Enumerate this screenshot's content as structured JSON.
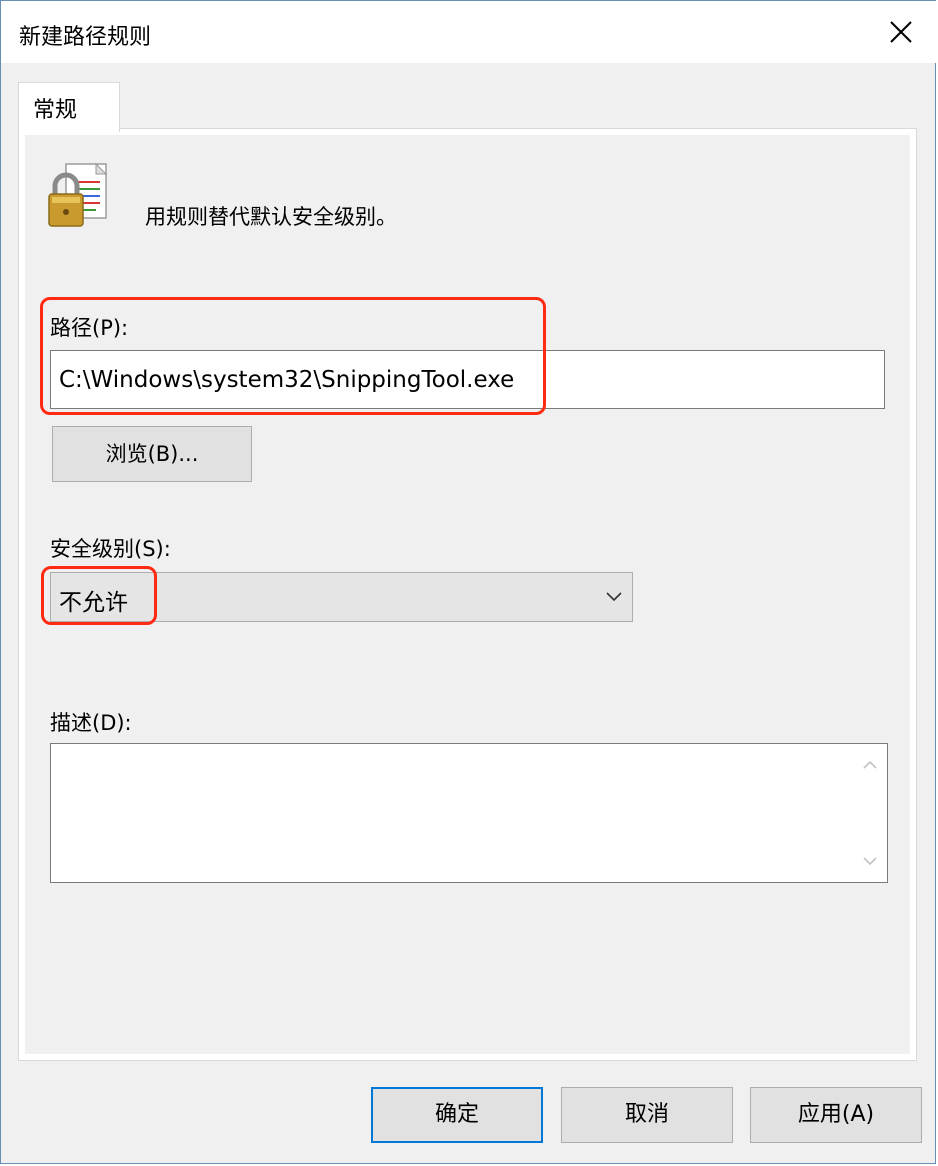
{
  "dialog": {
    "title": "新建路径规则",
    "tab_label": "常规",
    "description": "用规则替代默认安全级别。",
    "path": {
      "label": "路径(P):",
      "value": "C:\\Windows\\system32\\SnippingTool.exe"
    },
    "browse_label": "浏览(B)...",
    "security_level": {
      "label": "安全级别(S):",
      "selected": "不允许"
    },
    "notes": {
      "label": "描述(D):",
      "value": ""
    },
    "buttons": {
      "ok": "确定",
      "cancel": "取消",
      "apply": "应用(A)"
    }
  },
  "icons": {
    "close": "close-icon",
    "rule": "padlock-document-icon",
    "dropdown": "chevron-down-icon",
    "scroll_up": "scroll-up-icon",
    "scroll_down": "scroll-down-icon"
  },
  "colors": {
    "highlight": "#ff2a12",
    "focus_border": "#0078d7",
    "window_bg": "#f0f0f0"
  }
}
